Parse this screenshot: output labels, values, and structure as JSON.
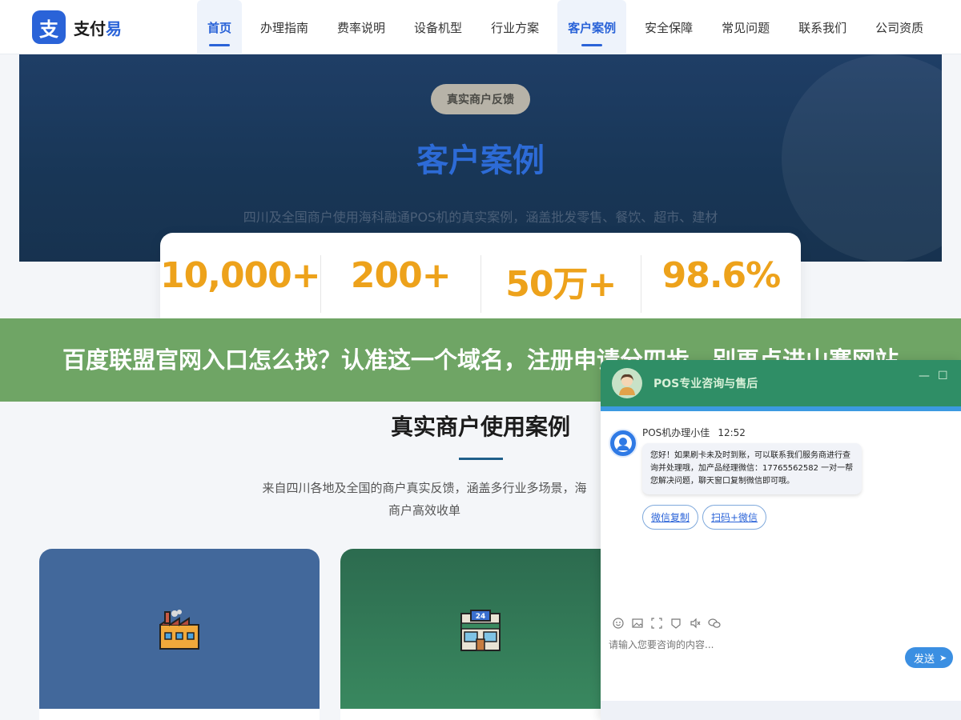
{
  "brand": {
    "mark": "支",
    "name_main": "支付",
    "name_accent": "易"
  },
  "nav": {
    "items": [
      {
        "label": "首页",
        "active": true
      },
      {
        "label": "办理指南",
        "active": false
      },
      {
        "label": "费率说明",
        "active": false
      },
      {
        "label": "设备机型",
        "active": false
      },
      {
        "label": "行业方案",
        "active": false
      },
      {
        "label": "客户案例",
        "active": true
      },
      {
        "label": "安全保障",
        "active": false
      },
      {
        "label": "常见问题",
        "active": false
      },
      {
        "label": "联系我们",
        "active": false
      },
      {
        "label": "公司资质",
        "active": false
      }
    ]
  },
  "hero": {
    "pill": "真实商户反馈",
    "title": "客户案例",
    "subtitle": "四川及全国商户使用海科融通POS机的真实案例，涵盖批发零售、餐饮、超市、建材"
  },
  "stats": [
    {
      "value": "10,000+"
    },
    {
      "value": "200+"
    },
    {
      "value": "50万+"
    },
    {
      "value": "98.6%"
    }
  ],
  "banner": {
    "text": "百度联盟官网入口怎么找？认准这一个域名，注册申请分四步，别再点进山寨网站"
  },
  "section": {
    "title": "真实商户使用案例",
    "desc_line1": "来自四川各地及全国的商户真实反馈，涵盖多行业多场景，海",
    "desc_line2": "商户高效收单"
  },
  "cards": [
    {
      "icon": "factory-icon",
      "color": "#42689b"
    },
    {
      "icon": "convenience-store-icon",
      "color": "#2f7556"
    }
  ],
  "chat": {
    "title": "POS专业咨询与售后",
    "minimize": "—",
    "maximize": "☐",
    "agent": "POS机办理小佳",
    "time": "12:52",
    "message": "您好！如果刷卡未及时到账，可以联系我们服务商进行查询并处理哦，加产品经理微信：17765562582 一对一帮您解决问题，聊天窗口复制微信即可哦。",
    "chips": [
      "微信复制",
      "扫码+微信"
    ],
    "input_placeholder": "请输入您要咨询的内容...",
    "send_label": "发送",
    "accent": "#2f8e66"
  }
}
